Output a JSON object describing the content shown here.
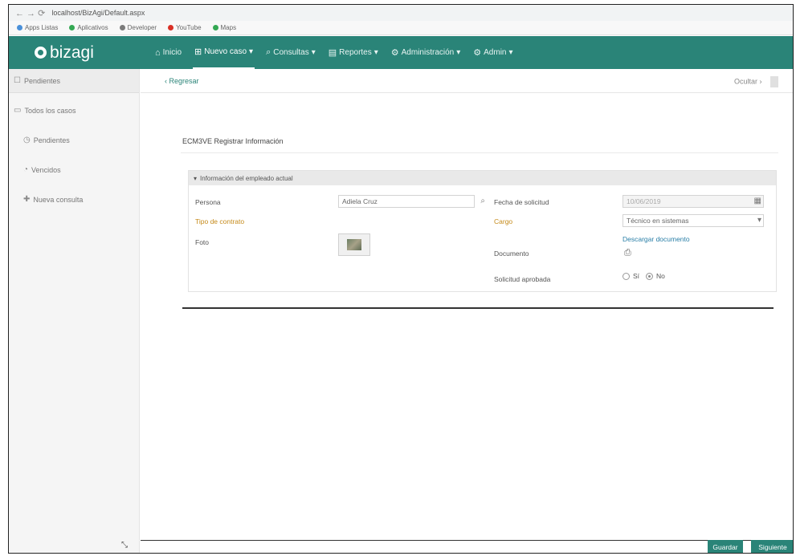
{
  "browser": {
    "nav_icons": "← → ⟳",
    "url": "localhost/BizAgi/Default.aspx",
    "bookmarks": [
      {
        "label": "Apps Listas",
        "color": "#4a90d9"
      },
      {
        "label": "Aplicativos",
        "color": "#34a853"
      },
      {
        "label": "Developer",
        "color": "#7b7b7b"
      },
      {
        "label": "YouTube",
        "color": "#d93025"
      },
      {
        "label": "Maps",
        "color": "#34a853"
      }
    ]
  },
  "header": {
    "logo_text": "bizagi",
    "menu": [
      {
        "label": "Inicio",
        "icon": "⌂",
        "active": false
      },
      {
        "label": "Nuevo caso",
        "icon": "⊞",
        "active": true
      },
      {
        "label": "Consultas",
        "icon": "⌕",
        "active": false
      },
      {
        "label": "Reportes",
        "icon": "▤",
        "active": false
      },
      {
        "label": "Administración",
        "icon": "⚙",
        "active": false
      },
      {
        "label": "Admin",
        "icon": "⚙",
        "active": false
      }
    ]
  },
  "sidebar": {
    "top_item": "Pendientes",
    "group": "Todos los casos",
    "items": [
      {
        "label": "Pendientes",
        "icon": "◷"
      },
      {
        "label": "Vencidos",
        "icon": "◔"
      },
      {
        "label": "Nueva consulta",
        "icon": "✚"
      }
    ],
    "bottom_icon": "⤡"
  },
  "main": {
    "breadcrumb": "‹ Regresar",
    "right_label": "Ocultar",
    "case_title": "ECM3VE Registrar Información",
    "panel_title": "Información del empleado actual",
    "fields": {
      "persona_label": "Persona",
      "persona_value": "Adiela Cruz",
      "fecha_label": "Fecha de solicitud",
      "fecha_value": "10/06/2019",
      "tipo_label": "Tipo de contrato",
      "cargo_label": "Cargo",
      "cargo_value": "Técnico en sistemas",
      "foto_label": "Foto",
      "documento_label": "Documento",
      "documento_link": "Descargar documento",
      "documento_icon": "⎙",
      "aprobado_label": "Solicitud aprobada",
      "radio_si": "Sí",
      "radio_no": "No"
    }
  },
  "footer": {
    "save_label": "Guardar",
    "next_label": "Siguiente"
  }
}
